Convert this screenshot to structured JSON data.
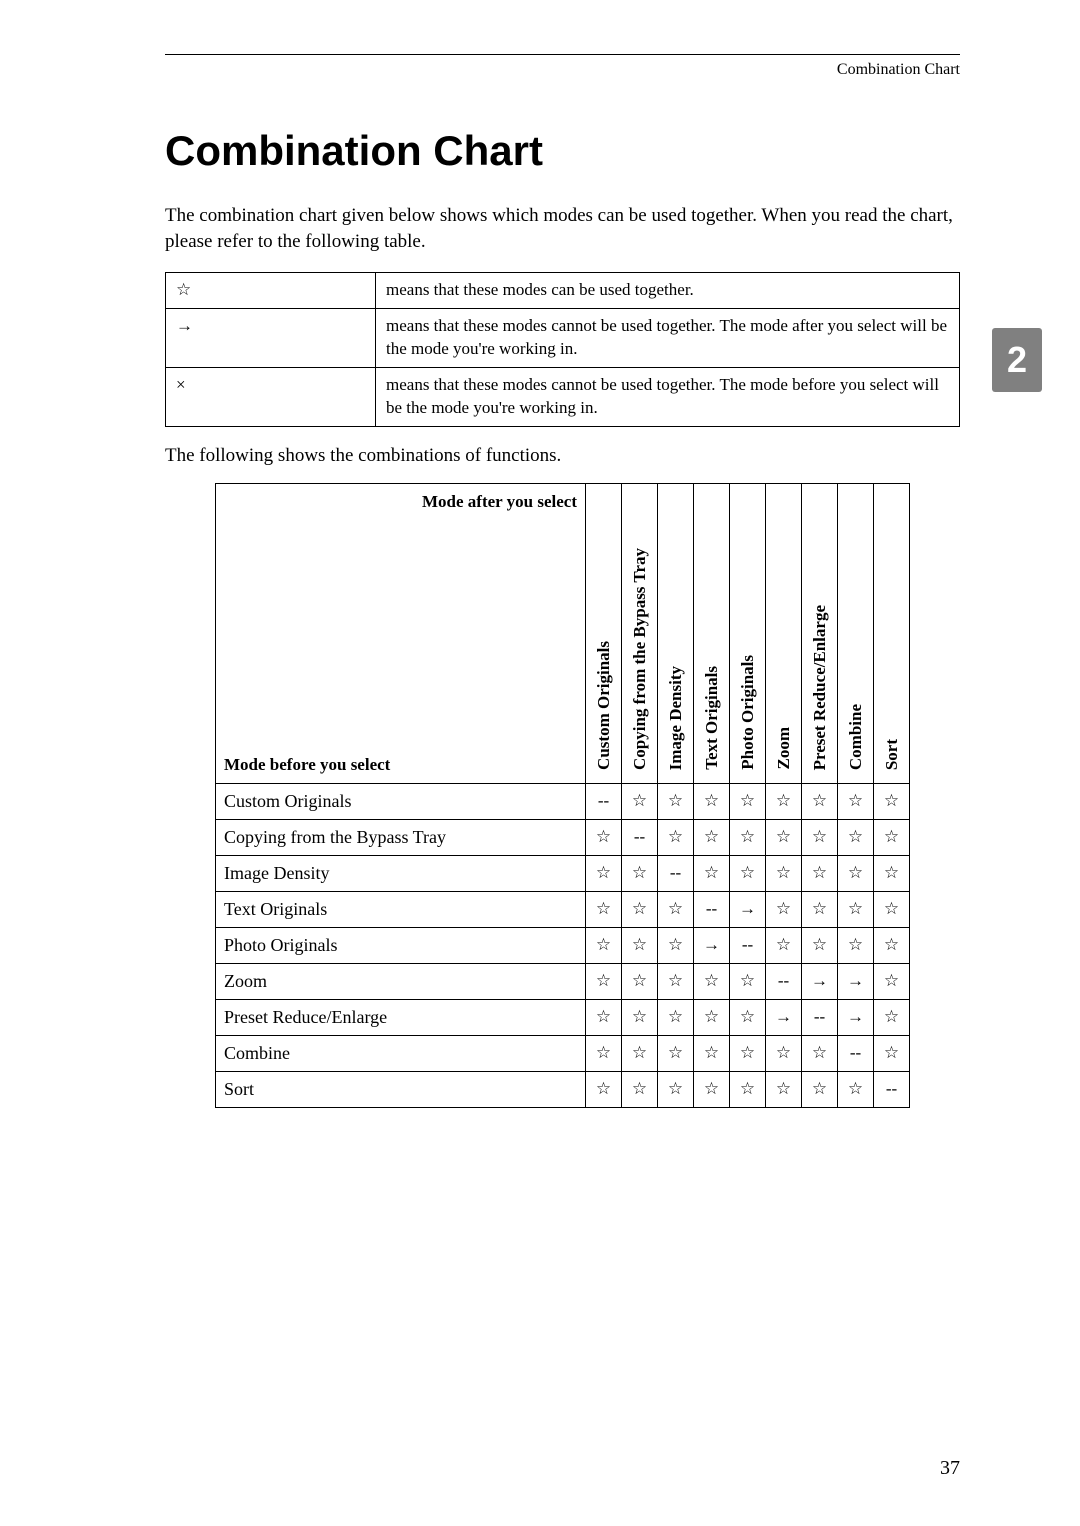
{
  "header": {
    "section": "Combination Chart"
  },
  "title": "Combination Chart",
  "intro": "The combination chart given below shows which modes can be used together. When you read the chart, please refer to the following table.",
  "legend": [
    {
      "symbol": "☆",
      "meaning": "means that these modes can be used together."
    },
    {
      "symbol": "→",
      "meaning": "means that these modes cannot be used together. The mode after you select will be the mode you're working in."
    },
    {
      "symbol": "×",
      "meaning": "means that these modes cannot be used together. The mode before you select will be the mode you're working in."
    }
  ],
  "subtext": "The following shows the combinations of functions.",
  "tab": "2",
  "pageNumber": "37",
  "chart_data": {
    "type": "table",
    "corner_top": "Mode after you select",
    "corner_bottom": "Mode before you select",
    "columns": [
      "Custom Originals",
      "Copying from the Bypass Tray",
      "Image Density",
      "Text Originals",
      "Photo Originals",
      "Zoom",
      "Preset Reduce/Enlarge",
      "Combine",
      "Sort"
    ],
    "rows": [
      "Custom Originals",
      "Copying from the Bypass Tray",
      "Image Density",
      "Text Originals",
      "Photo Originals",
      "Zoom",
      "Preset Reduce/Enlarge",
      "Combine",
      "Sort"
    ],
    "cells": [
      [
        "--",
        "☆",
        "☆",
        "☆",
        "☆",
        "☆",
        "☆",
        "☆",
        "☆"
      ],
      [
        "☆",
        "--",
        "☆",
        "☆",
        "☆",
        "☆",
        "☆",
        "☆",
        "☆"
      ],
      [
        "☆",
        "☆",
        "--",
        "☆",
        "☆",
        "☆",
        "☆",
        "☆",
        "☆"
      ],
      [
        "☆",
        "☆",
        "☆",
        "--",
        "→",
        "☆",
        "☆",
        "☆",
        "☆"
      ],
      [
        "☆",
        "☆",
        "☆",
        "→",
        "--",
        "☆",
        "☆",
        "☆",
        "☆"
      ],
      [
        "☆",
        "☆",
        "☆",
        "☆",
        "☆",
        "--",
        "→",
        "→",
        "☆"
      ],
      [
        "☆",
        "☆",
        "☆",
        "☆",
        "☆",
        "→",
        "--",
        "→",
        "☆"
      ],
      [
        "☆",
        "☆",
        "☆",
        "☆",
        "☆",
        "☆",
        "☆",
        "--",
        "☆"
      ],
      [
        "☆",
        "☆",
        "☆",
        "☆",
        "☆",
        "☆",
        "☆",
        "☆",
        "--"
      ]
    ]
  }
}
